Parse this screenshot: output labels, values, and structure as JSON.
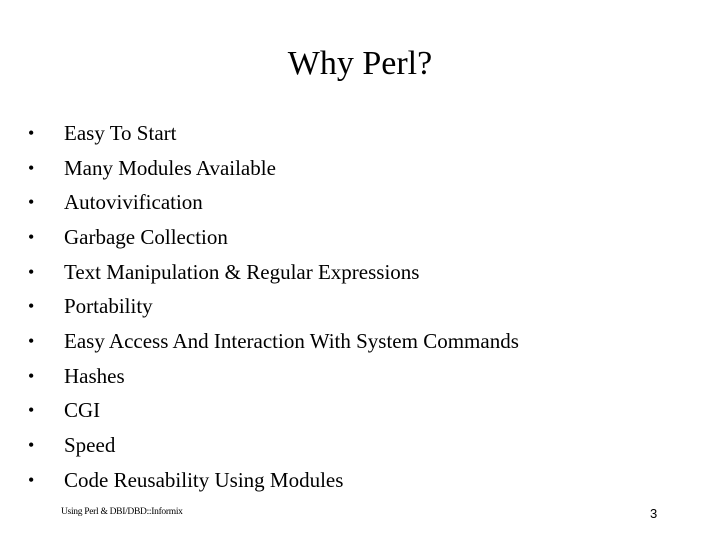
{
  "slide": {
    "title": "Why Perl?",
    "bullets": [
      "Easy To Start",
      "Many Modules Available",
      "Autovivification",
      "Garbage Collection",
      "Text Manipulation & Regular Expressions",
      "Portability",
      "Easy Access And Interaction With System Commands",
      "Hashes",
      "CGI",
      "Speed",
      "Code Reusability Using Modules"
    ],
    "bullet_symbol": "•",
    "footer": "Using Perl & DBI/DBD::Informix",
    "page_number": "3"
  }
}
